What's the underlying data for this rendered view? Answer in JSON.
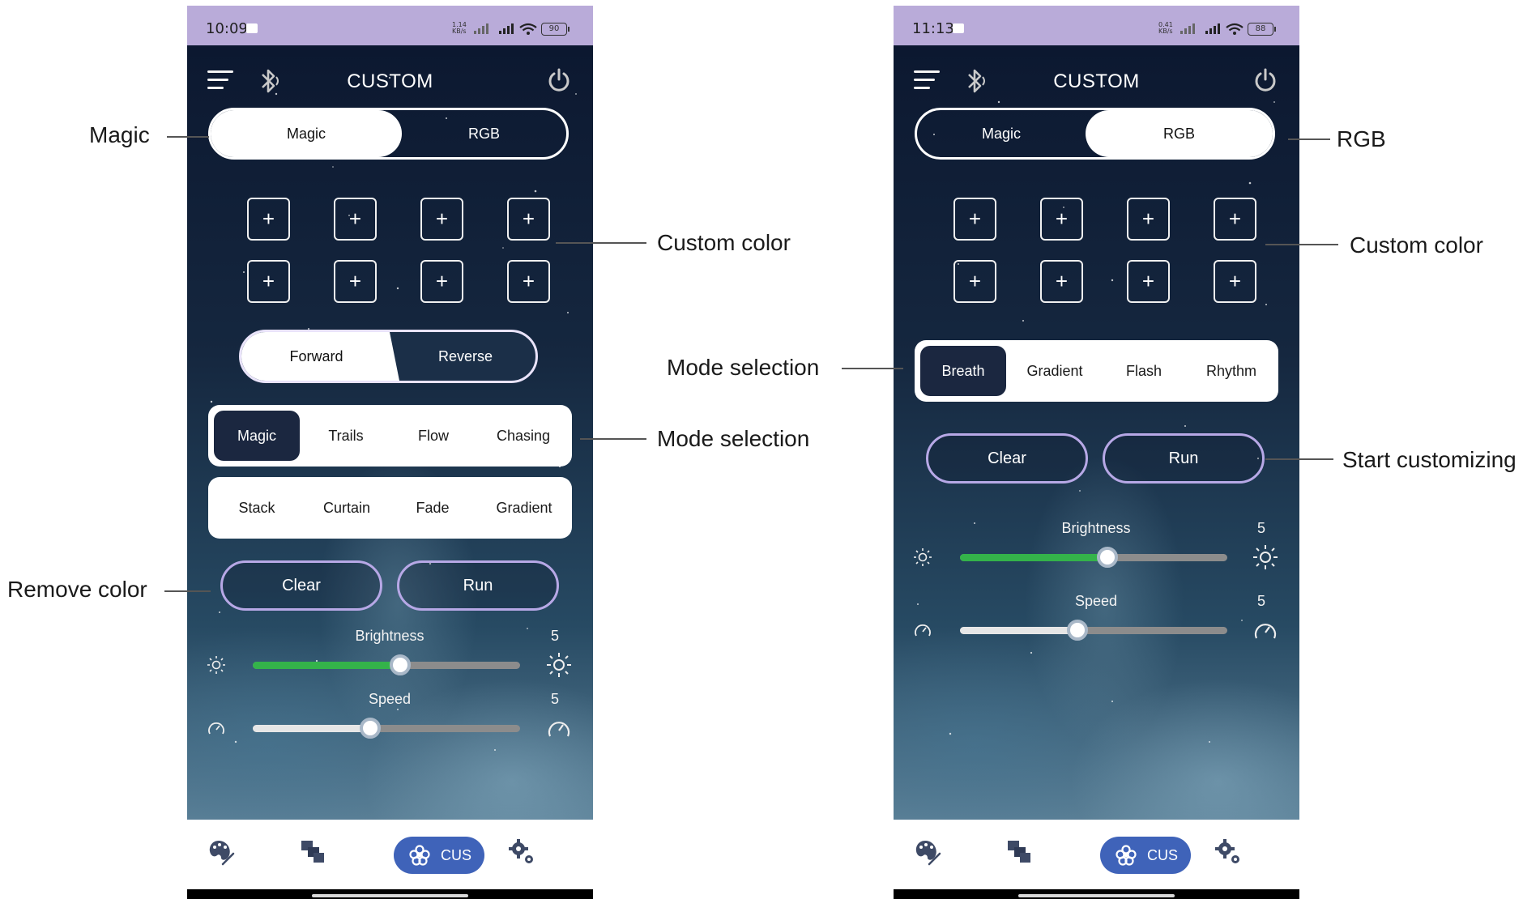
{
  "left_screen": {
    "status": {
      "time": "10:09",
      "net_speed": "1.14",
      "net_unit": "KB/s",
      "hd": "HD",
      "battery": "90"
    },
    "header": {
      "title": "CUSTOM"
    },
    "tabs": {
      "magic": "Magic",
      "rgb": "RGB",
      "selected": "Magic"
    },
    "color_slots": [
      "+",
      "+",
      "+",
      "+",
      "+",
      "+",
      "+",
      "+"
    ],
    "direction": {
      "forward": "Forward",
      "reverse": "Reverse",
      "selected": "Forward"
    },
    "modes_row1": [
      "Magic",
      "Trails",
      "Flow",
      "Chasing"
    ],
    "modes_row2": [
      "Stack",
      "Curtain",
      "Fade",
      "Gradient"
    ],
    "active_mode": "Magic",
    "buttons": {
      "clear": "Clear",
      "run": "Run"
    },
    "brightness": {
      "label": "Brightness",
      "value": "5",
      "fraction": 0.55
    },
    "speed": {
      "label": "Speed",
      "value": "5",
      "fraction": 0.44
    },
    "nav": {
      "active_label": "CUS"
    }
  },
  "right_screen": {
    "status": {
      "time": "11:13",
      "net_speed": "0.41",
      "net_unit": "KB/s",
      "hd": "HD",
      "battery": "88"
    },
    "header": {
      "title": "CUSTOM"
    },
    "tabs": {
      "magic": "Magic",
      "rgb": "RGB",
      "selected": "RGB"
    },
    "color_slots": [
      "+",
      "+",
      "+",
      "+",
      "+",
      "+",
      "+",
      "+"
    ],
    "modes": [
      "Breath",
      "Gradient",
      "Flash",
      "Rhythm"
    ],
    "active_mode": "Breath",
    "buttons": {
      "clear": "Clear",
      "run": "Run"
    },
    "brightness": {
      "label": "Brightness",
      "value": "5",
      "fraction": 0.55
    },
    "speed": {
      "label": "Speed",
      "value": "5",
      "fraction": 0.44
    },
    "nav": {
      "active_label": "CUS"
    }
  },
  "annotations": {
    "left": {
      "magic": "Magic",
      "custom_color": "Custom color",
      "mode_selection": "Mode selection",
      "remove_color": "Remove color"
    },
    "right": {
      "rgb": "RGB",
      "custom_color": "Custom color",
      "mode_selection": "Mode selection",
      "start_customizing": "Start customizing"
    }
  },
  "colors": {
    "status_bar": "#b9abd9",
    "slider_fill_green": "#34b34a",
    "slider_fill_white": "#e6e6e6",
    "active_mode_bg": "#1b2740",
    "nav_pill": "#3f63b9",
    "button_border": "#b7a8e6"
  },
  "icons": [
    "menu-icon",
    "bluetooth-icon",
    "power-icon",
    "sun-icon",
    "speedometer-icon",
    "palette-icon",
    "layers-icon",
    "flower-icon",
    "settings-gears-icon"
  ]
}
